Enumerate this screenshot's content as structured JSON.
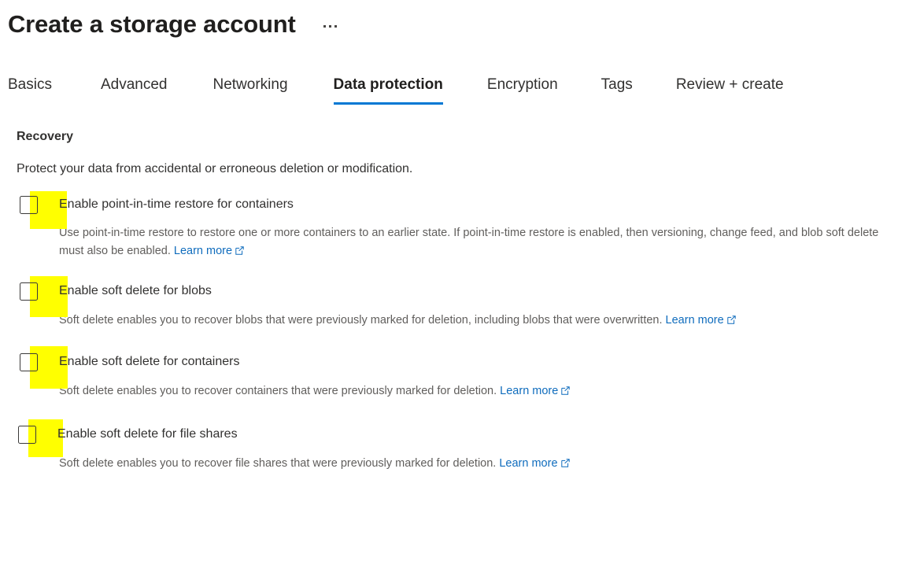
{
  "header": {
    "title": "Create a storage account",
    "more_menu_label": "..."
  },
  "tabs": [
    {
      "label": "Basics",
      "selected": false
    },
    {
      "label": "Advanced",
      "selected": false
    },
    {
      "label": "Networking",
      "selected": false
    },
    {
      "label": "Data protection",
      "selected": true
    },
    {
      "label": "Encryption",
      "selected": false
    },
    {
      "label": "Tags",
      "selected": false
    },
    {
      "label": "Review + create",
      "selected": false
    }
  ],
  "section": {
    "heading": "Recovery",
    "description": "Protect your data from accidental or erroneous deletion or modification."
  },
  "options": [
    {
      "label": "Enable point-in-time restore for containers",
      "checked": false,
      "highlighted": true,
      "description": "Use point-in-time restore to restore one or more containers to an earlier state. If point-in-time restore is enabled, then versioning, change feed, and blob soft delete must also be enabled.",
      "link_text": "Learn more"
    },
    {
      "label": "Enable soft delete for blobs",
      "checked": false,
      "highlighted": true,
      "description": "Soft delete enables you to recover blobs that were previously marked for deletion, including blobs that were overwritten.",
      "link_text": "Learn more"
    },
    {
      "label": "Enable soft delete for containers",
      "checked": false,
      "highlighted": true,
      "description": "Soft delete enables you to recover containers that were previously marked for deletion.",
      "link_text": "Learn more"
    },
    {
      "label": "Enable soft delete for file shares",
      "checked": false,
      "highlighted": true,
      "description": "Soft delete enables you to recover file shares that were previously marked for deletion.",
      "link_text": "Learn more"
    }
  ],
  "colors": {
    "accent": "#0078d4",
    "link": "#0f6cbd",
    "highlight": "#ffff00",
    "text_primary": "#323130",
    "text_secondary": "#605e5c",
    "checkbox_border": "#3b3a39"
  },
  "icons": {
    "external_link": "external-link-icon",
    "checkbox": "checkbox-unchecked-icon",
    "more": "ellipsis-icon"
  }
}
